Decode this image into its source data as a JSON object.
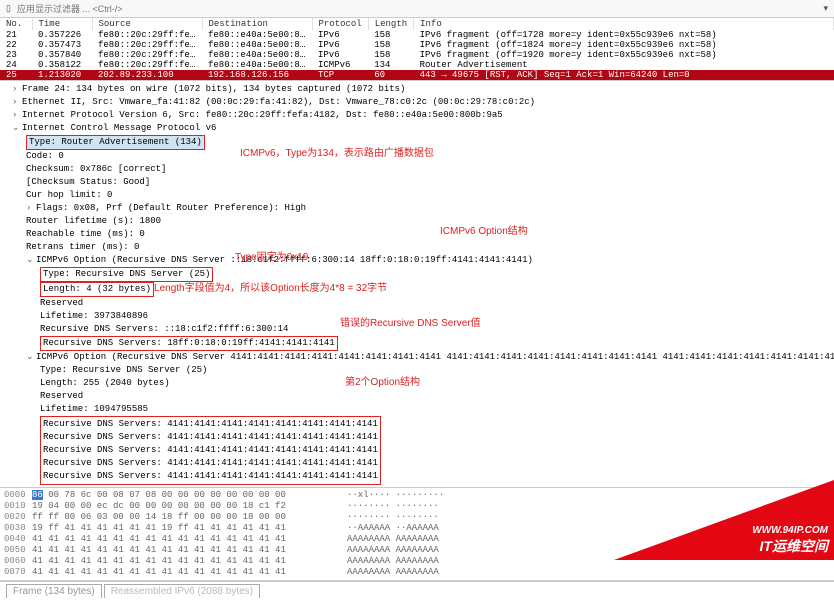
{
  "filter": {
    "placeholder": "应用显示过滤器 ... <Ctrl-/>"
  },
  "columns": {
    "no": "No.",
    "time": "Time",
    "source": "Source",
    "destination": "Destination",
    "protocol": "Protocol",
    "length": "Length",
    "info": "Info"
  },
  "packets": [
    {
      "no": "21",
      "time": "0.357226",
      "src": "fe80::20c:29ff:fe…",
      "dst": "fe80::e40a:5e00:8…",
      "proto": "IPv6",
      "len": "158",
      "info": "IPv6 fragment (off=1728 more=y ident=0x55c939e6 nxt=58)"
    },
    {
      "no": "22",
      "time": "0.357473",
      "src": "fe80::20c:29ff:fe…",
      "dst": "fe80::e40a:5e00:8…",
      "proto": "IPv6",
      "len": "158",
      "info": "IPv6 fragment (off=1824 more=y ident=0x55c939e6 nxt=58)"
    },
    {
      "no": "23",
      "time": "0.357840",
      "src": "fe80::20c:29ff:fe…",
      "dst": "fe80::e40a:5e00:8…",
      "proto": "IPv6",
      "len": "158",
      "info": "IPv6 fragment (off=1920 more=y ident=0x55c939e6 nxt=58)"
    },
    {
      "no": "24",
      "time": "0.358122",
      "src": "fe80::20c:29ff:fe…",
      "dst": "fe80::e40a:5e00:8…",
      "proto": "ICMPv6",
      "len": "134",
      "info": "Router Advertisement"
    },
    {
      "no": "25",
      "time": "1.213020",
      "src": "202.89.233.100",
      "dst": "192.168.126.156",
      "proto": "TCP",
      "len": "60",
      "info": "443 → 49675 [RST, ACK] Seq=1 Ack=1 Win=64240 Len=0"
    }
  ],
  "details": {
    "frame": "Frame 24: 134 bytes on wire (1072 bits), 134 bytes captured (1072 bits)",
    "eth": "Ethernet II, Src: Vmware_fa:41:82 (00:0c:29:fa:41:82), Dst: Vmware_78:c0:2c (00:0c:29:78:c0:2c)",
    "ipv6": "Internet Protocol Version 6, Src: fe80::20c:29ff:fefa:4182, Dst: fe80::e40a:5e00:800b:9a5",
    "icmp": "Internet Control Message Protocol v6",
    "type": "Type: Router Advertisement (134)",
    "code": "Code: 0",
    "checksum": "Checksum: 0x786c [correct]",
    "checksum_status": "[Checksum Status: Good]",
    "cur_hop": "Cur hop limit: 0",
    "flags": "Flags: 0x08, Prf (Default Router Preference): High",
    "router_lifetime": "Router lifetime (s): 1800",
    "reachable": "Reachable time (ms): 0",
    "retrans": "Retrans timer (ms): 0",
    "opt1_hdr": "ICMPv6 Option (Recursive DNS Server ::18:c1f2:ffff:6:300:14 18ff:0:18:0:19ff:4141:4141:4141)",
    "opt1_type": "Type: Recursive DNS Server (25)",
    "opt1_len": "Length: 4 (32 bytes)",
    "opt1_reserved": "Reserved",
    "opt1_lifetime": "Lifetime: 3973840896",
    "opt1_dns1": "Recursive DNS Servers: ::18:c1f2:ffff:6:300:14",
    "opt1_dns2": "Recursive DNS Servers: 18ff:0:18:0:19ff:4141:4141:4141",
    "opt2_hdr": "ICMPv6 Option (Recursive DNS Server 4141:4141:4141:4141:4141:4141:4141:4141 4141:4141:4141:4141:4141:4141:4141:4141 4141:4141:4141:4141:4141:4141:4141:4141 4141:4141:4141:4141:4141:4141:4141:4141 4141",
    "opt2_type": "Type: Recursive DNS Server (25)",
    "opt2_len": "Length: 255 (2040 bytes)",
    "opt2_reserved": "Reserved",
    "opt2_lifetime": "Lifetime: 1094795585",
    "opt2_dns1": "Recursive DNS Servers: 4141:4141:4141:4141:4141:4141:4141:4141",
    "opt2_dns2": "Recursive DNS Servers: 4141:4141:4141:4141:4141:4141:4141:4141",
    "opt2_dns3": "Recursive DNS Servers: 4141:4141:4141:4141:4141:4141:4141:4141",
    "opt2_dns4": "Recursive DNS Servers: 4141:4141:4141:4141:4141:4141:4141:4141",
    "opt2_dns5": "Recursive DNS Servers: 4141:4141:4141:4141:4141:4141:4141:4141"
  },
  "annotations": {
    "a1": "ICMPv6，Type为134，表示路由广播数据包",
    "a2": "ICMPv6 Option结构",
    "a3": "Type固定为0x19",
    "a4": "Length字段值为4，所以该Option长度为4*8 = 32字节",
    "a5": "错误的Recursive DNS Server值",
    "a6": "第2个Option结构"
  },
  "hex": [
    {
      "off": "0000",
      "b0": "86",
      "b": "00 78 6c 00 08 07 08  00 00 00 00 00 00 00 00",
      "asc": "··xl···· ·········"
    },
    {
      "off": "0010",
      "b": "19 04 00 00 ec dc 00 00  00 00 00 00 00 18 c1 f2",
      "asc": "········ ········"
    },
    {
      "off": "0020",
      "b": "ff ff 00 06 03 00 00 14  18 ff 00 00 00 18 00 00",
      "asc": "········ ········"
    },
    {
      "off": "0030",
      "b": "19 ff 41 41 41 41 41 41  19 ff 41 41 41 41 41 41",
      "asc": "··AAAAAA ··AAAAAA"
    },
    {
      "off": "0040",
      "b": "41 41 41 41 41 41 41 41  41 41 41 41 41 41 41 41",
      "asc": "AAAAAAAA AAAAAAAA"
    },
    {
      "off": "0050",
      "b": "41 41 41 41 41 41 41 41  41 41 41 41 41 41 41 41",
      "asc": "AAAAAAAA AAAAAAAA"
    },
    {
      "off": "0060",
      "b": "41 41 41 41 41 41 41 41  41 41 41 41 41 41 41 41",
      "asc": "AAAAAAAA AAAAAAAA"
    },
    {
      "off": "0070",
      "b": "41 41 41 41 41 41 41 41  41 41 41 41 41 41 41 41",
      "asc": "AAAAAAAA AAAAAAAA"
    }
  ],
  "status": {
    "tab1": "Frame (134 bytes)",
    "tab2": "Reassembled IPv6 (2088 bytes)"
  },
  "watermark": {
    "url": "WWW.94IP.COM",
    "text": "IT运维空间"
  }
}
